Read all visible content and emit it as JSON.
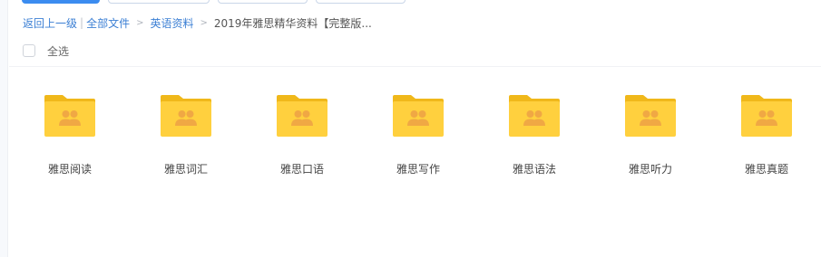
{
  "breadcrumb": {
    "back": "返回上一级",
    "separator": "|",
    "all_files": "全部文件",
    "arrow": ">",
    "folder": "英语资料",
    "current": "2019年雅思精华资料【完整版..."
  },
  "selection": {
    "select_all_label": "全选"
  },
  "folders": [
    {
      "name": "雅思阅读",
      "icon": "shared-folder-icon"
    },
    {
      "name": "雅思词汇",
      "icon": "shared-folder-icon"
    },
    {
      "name": "雅思口语",
      "icon": "shared-folder-icon"
    },
    {
      "name": "雅思写作",
      "icon": "shared-folder-icon"
    },
    {
      "name": "雅思语法",
      "icon": "shared-folder-icon"
    },
    {
      "name": "雅思听力",
      "icon": "shared-folder-icon"
    },
    {
      "name": "雅思真题",
      "icon": "shared-folder-icon"
    }
  ],
  "colors": {
    "folder_body": "#FFD03E",
    "folder_tab": "#F0B81A",
    "folder_people": "#F0A844",
    "link": "#3B7FD4",
    "primary_button": "#3B8CF0"
  }
}
